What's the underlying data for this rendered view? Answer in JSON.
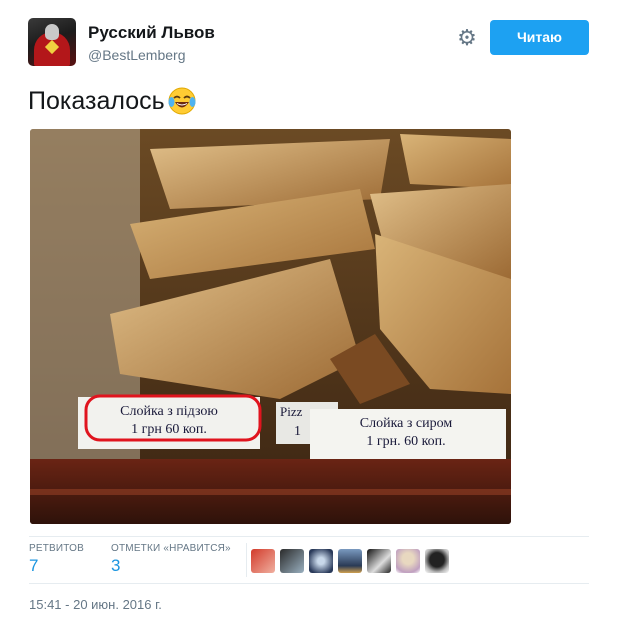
{
  "user": {
    "display_name": "Русский Львов",
    "screen_name": "@BestLemberg"
  },
  "follow_button": {
    "label": "Читаю"
  },
  "tweet": {
    "text": "Показалось",
    "emoji": "face-with-tears-of-joy",
    "image": {
      "price_tag_left": {
        "line1": "Слойка з підзою",
        "line2": "1 грн 60 коп."
      },
      "price_tag_middle": {
        "line1": "Pizz",
        "line2": "1"
      },
      "price_tag_right": {
        "line1": "Слойка з сиром",
        "line2": "1 грн. 60 коп."
      }
    }
  },
  "stats": {
    "retweets": {
      "label": "РЕТВИТОВ",
      "value": "7"
    },
    "likes": {
      "label": "ОТМЕТКИ «НРАВИТСЯ»",
      "value": "3"
    }
  },
  "timestamp": "15:41 - 20 июн. 2016 г.",
  "colors": {
    "accent": "#1da1f2",
    "link": "#1b95e0",
    "muted": "#657786",
    "highlight_circle": "#e0141e"
  }
}
